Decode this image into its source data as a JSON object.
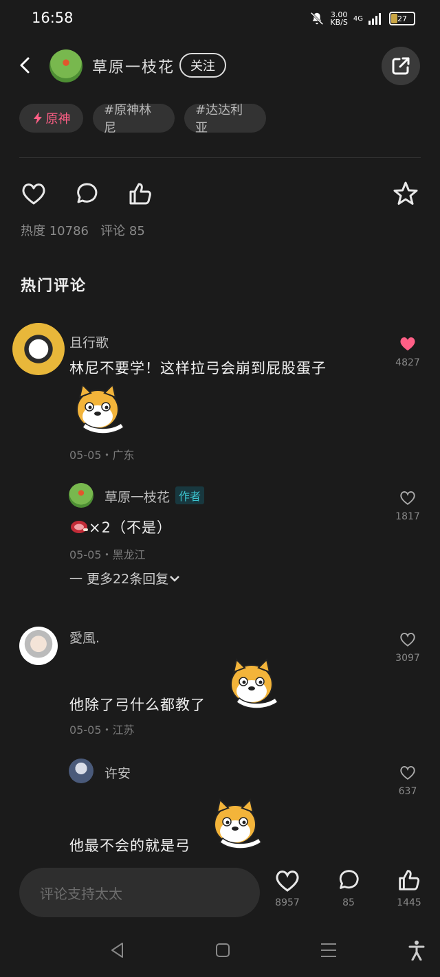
{
  "status": {
    "time": "16:58",
    "speed": "3.00",
    "speed_unit": "KB/S",
    "network": "4G",
    "battery": "27",
    "battery_level": 0.27
  },
  "header": {
    "author": "草原一枝花",
    "follow_label": "关注"
  },
  "tags": [
    {
      "label": "原神"
    },
    {
      "label": "#原神林尼"
    },
    {
      "label": "#达达利亚"
    }
  ],
  "stats": {
    "heat_label": "热度",
    "heat": "10786",
    "comment_label": "评论",
    "comments": "85"
  },
  "section_title": "热门评论",
  "comments": [
    {
      "user": "且行歌",
      "text": "林尼不要学！这样拉弓会崩到屁股蛋子",
      "meta": "05-05・广东",
      "likes": "4827",
      "liked": true
    },
    {
      "user": "草原一枝花",
      "badge": "作者",
      "text": "×2（不是）",
      "meta": "05-05・黑龙江",
      "likes": "1817",
      "more": "一 更多22条回复"
    },
    {
      "user": "愛風.",
      "text": "他除了弓什么都教了",
      "meta": "05-05・江苏",
      "likes": "3097"
    },
    {
      "user": "许安",
      "text": "他最不会的就是弓",
      "likes": "637"
    }
  ],
  "bottom": {
    "placeholder": "评论支持太太",
    "likes": "8957",
    "comments": "85",
    "thumbs": "1445"
  },
  "colors": {
    "accent_pink": "#ff5f86",
    "badge_teal": "#3cc4cf",
    "background": "#1b1b1b"
  }
}
